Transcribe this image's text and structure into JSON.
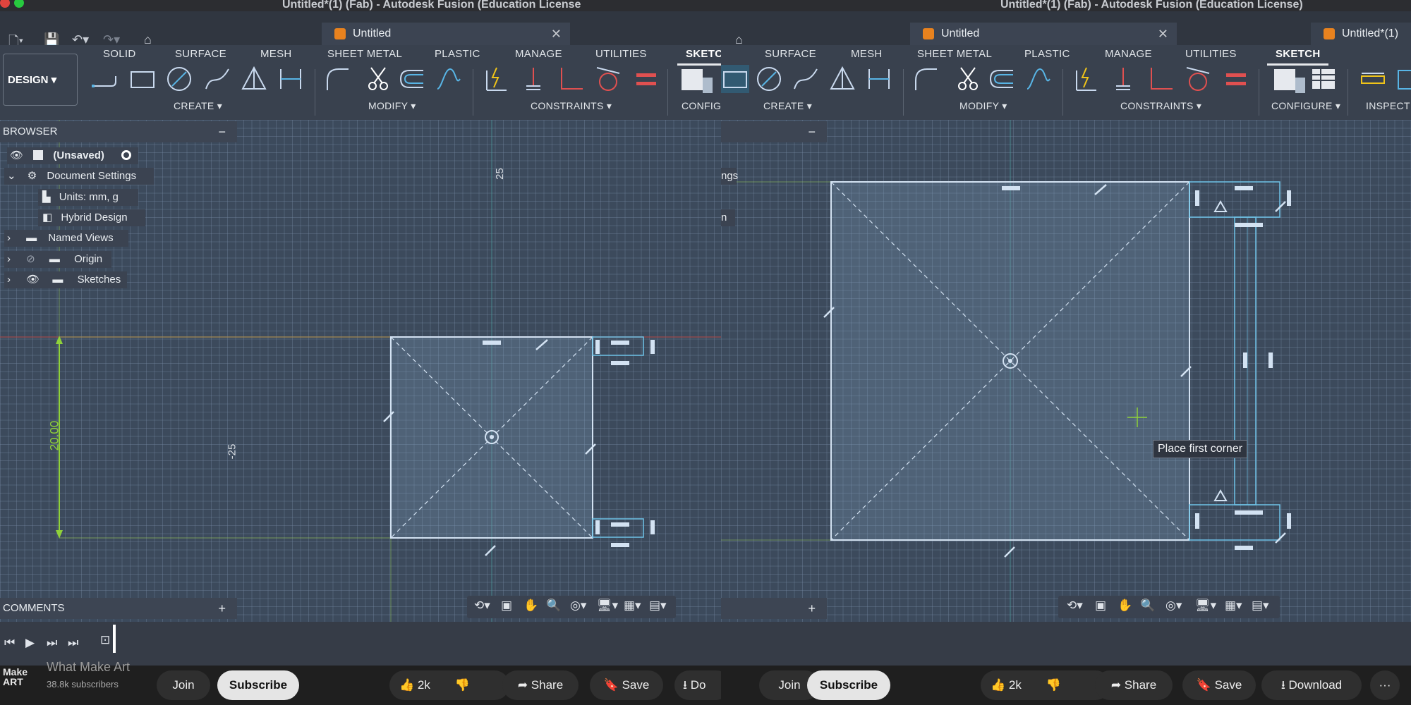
{
  "left": {
    "window_title": "Untitled*(1) (Fab) - Autodesk Fusion (Education License",
    "doc_tab": "Untitled",
    "design_label": "DESIGN",
    "ribbon_tabs": [
      "SOLID",
      "SURFACE",
      "MESH",
      "SHEET METAL",
      "PLASTIC",
      "MANAGE",
      "UTILITIES",
      "SKETCH"
    ],
    "groups": [
      "CREATE",
      "MODIFY",
      "CONSTRAINTS",
      "CONFIG"
    ],
    "browser": {
      "title": "BROWSER",
      "root": "(Unsaved)",
      "items": [
        "Document Settings",
        "Units: mm, g",
        "Hybrid Design",
        "Named Views",
        "Origin",
        "Sketches"
      ]
    },
    "comments": "COMMENTS",
    "dims": {
      "top": "25",
      "mid": "-25",
      "height": "20.00"
    }
  },
  "right": {
    "window_title": "Untitled*(1) (Fab) - Autodesk Fusion (Education License)",
    "doc_tab": "Untitled",
    "doc_tab_2": "Untitled*(1)",
    "ribbon_tabs": [
      "SURFACE",
      "MESH",
      "SHEET METAL",
      "PLASTIC",
      "MANAGE",
      "UTILITIES",
      "SKETCH"
    ],
    "groups": [
      "CREATE",
      "MODIFY",
      "CONSTRAINTS",
      "CONFIGURE",
      "INSPECT"
    ],
    "browser_partial": [
      "ngs",
      "n"
    ],
    "tooltip": "Place first corner"
  },
  "youtube_left": {
    "channel_logo": "Make ART",
    "channel": "What Make Art",
    "subscribers": "38.8k subscribers",
    "join": "Join",
    "subscribe": "Subscribe",
    "likes": "2k",
    "share": "Share",
    "save": "Save",
    "download": "Do"
  },
  "youtube_right": {
    "join": "Join",
    "subscribe": "Subscribe",
    "likes": "2k",
    "share": "Share",
    "save": "Save",
    "download": "Download",
    "more": "···"
  },
  "colors": {
    "sketch_line": "#b9d4ee",
    "selected_line": "#6ec3e8",
    "dimension_green": "#8fd13a",
    "axis_red": "#b04a4a",
    "brand_orange": "#e8821e"
  }
}
